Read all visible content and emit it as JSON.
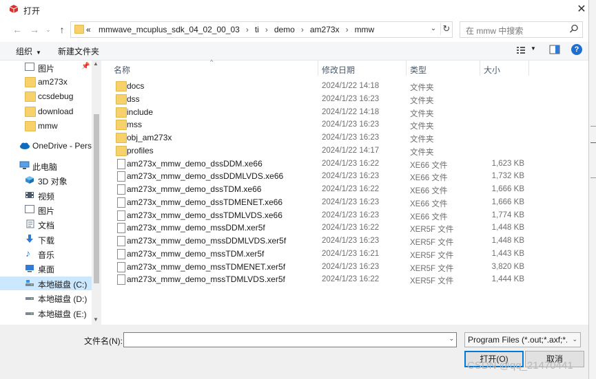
{
  "window": {
    "title": "打开"
  },
  "address": {
    "crumbs": [
      "«",
      "mmwave_mcuplus_sdk_04_02_00_03",
      "ti",
      "demo",
      "am273x",
      "mmw"
    ]
  },
  "search": {
    "placeholder": "在 mmw 中搜索"
  },
  "toolbar": {
    "organize": "组织",
    "new_folder": "新建文件夹"
  },
  "nav": {
    "items": [
      {
        "label": "图片",
        "icon": "pictures-icon"
      },
      {
        "label": "am273x",
        "icon": "folder-icon"
      },
      {
        "label": "ccsdebug",
        "icon": "folder-icon"
      },
      {
        "label": "download",
        "icon": "folder-icon"
      },
      {
        "label": "mmw",
        "icon": "folder-icon"
      },
      {
        "label": "OneDrive - Perso",
        "icon": "onedrive-icon"
      },
      {
        "label": "此电脑",
        "icon": "pc-icon"
      },
      {
        "label": "3D 对象",
        "icon": "3d-objects-icon"
      },
      {
        "label": "视频",
        "icon": "video-icon"
      },
      {
        "label": "图片",
        "icon": "pictures-icon"
      },
      {
        "label": "文档",
        "icon": "documents-icon"
      },
      {
        "label": "下载",
        "icon": "downloads-icon"
      },
      {
        "label": "音乐",
        "icon": "music-icon"
      },
      {
        "label": "桌面",
        "icon": "desktop-icon"
      },
      {
        "label": "本地磁盘 (C:)",
        "icon": "drive-icon"
      },
      {
        "label": "本地磁盘 (D:)",
        "icon": "drive-icon"
      },
      {
        "label": "本地磁盘 (E:)",
        "icon": "drive-icon"
      }
    ]
  },
  "columns": {
    "name": "名称",
    "date": "修改日期",
    "type": "类型",
    "size": "大小"
  },
  "files": [
    {
      "name": "docs",
      "date": "2024/1/22 14:18",
      "type": "文件夹",
      "size": "",
      "kind": "folder"
    },
    {
      "name": "dss",
      "date": "2024/1/23 16:23",
      "type": "文件夹",
      "size": "",
      "kind": "folder"
    },
    {
      "name": "include",
      "date": "2024/1/22 14:18",
      "type": "文件夹",
      "size": "",
      "kind": "folder"
    },
    {
      "name": "mss",
      "date": "2024/1/23 16:23",
      "type": "文件夹",
      "size": "",
      "kind": "folder"
    },
    {
      "name": "obj_am273x",
      "date": "2024/1/23 16:23",
      "type": "文件夹",
      "size": "",
      "kind": "folder"
    },
    {
      "name": "profiles",
      "date": "2024/1/22 14:17",
      "type": "文件夹",
      "size": "",
      "kind": "folder"
    },
    {
      "name": "am273x_mmw_demo_dssDDM.xe66",
      "date": "2024/1/23 16:22",
      "type": "XE66 文件",
      "size": "1,623 KB",
      "kind": "file"
    },
    {
      "name": "am273x_mmw_demo_dssDDMLVDS.xe66",
      "date": "2024/1/23 16:23",
      "type": "XE66 文件",
      "size": "1,732 KB",
      "kind": "file"
    },
    {
      "name": "am273x_mmw_demo_dssTDM.xe66",
      "date": "2024/1/23 16:22",
      "type": "XE66 文件",
      "size": "1,666 KB",
      "kind": "file"
    },
    {
      "name": "am273x_mmw_demo_dssTDMENET.xe66",
      "date": "2024/1/23 16:23",
      "type": "XE66 文件",
      "size": "1,666 KB",
      "kind": "file"
    },
    {
      "name": "am273x_mmw_demo_dssTDMLVDS.xe66",
      "date": "2024/1/23 16:23",
      "type": "XE66 文件",
      "size": "1,774 KB",
      "kind": "file"
    },
    {
      "name": "am273x_mmw_demo_mssDDM.xer5f",
      "date": "2024/1/23 16:22",
      "type": "XER5F 文件",
      "size": "1,448 KB",
      "kind": "file"
    },
    {
      "name": "am273x_mmw_demo_mssDDMLVDS.xer5f",
      "date": "2024/1/23 16:23",
      "type": "XER5F 文件",
      "size": "1,448 KB",
      "kind": "file"
    },
    {
      "name": "am273x_mmw_demo_mssTDM.xer5f",
      "date": "2024/1/23 16:21",
      "type": "XER5F 文件",
      "size": "1,443 KB",
      "kind": "file"
    },
    {
      "name": "am273x_mmw_demo_mssTDMENET.xer5f",
      "date": "2024/1/23 16:23",
      "type": "XER5F 文件",
      "size": "3,820 KB",
      "kind": "file"
    },
    {
      "name": "am273x_mmw_demo_mssTDMLVDS.xer5f",
      "date": "2024/1/23 16:22",
      "type": "XER5F 文件",
      "size": "1,444 KB",
      "kind": "file"
    }
  ],
  "bottom": {
    "filename_label": "文件名(N):",
    "filename_value": "",
    "filter": "Program Files (*.out;*.axf;*.x*",
    "open": "打开(O)",
    "cancel": "取消"
  },
  "watermark": "CSDN @qq_21470441",
  "colors": {
    "accent": "#0078d7",
    "folder": "#f7d26a",
    "selection": "#cce8ff"
  }
}
